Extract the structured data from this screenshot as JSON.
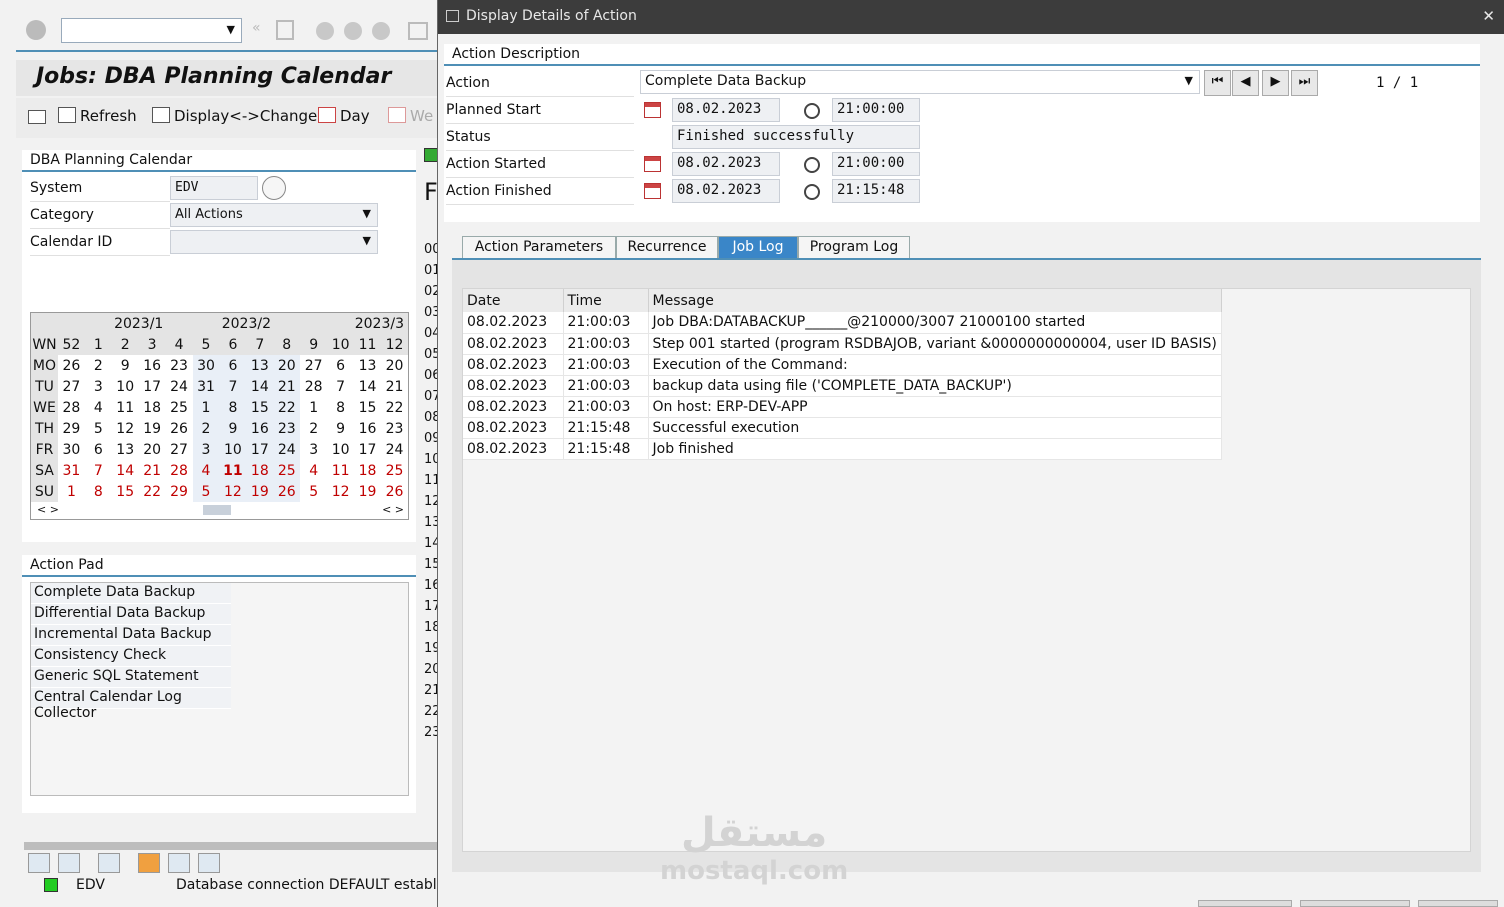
{
  "background": {
    "title": "Jobs: DBA Planning Calendar",
    "toolbar": {
      "refresh": "Refresh",
      "display_change": "Display<->Change",
      "day": "Day",
      "week": "We"
    },
    "calendar_panel": {
      "header": "DBA Planning Calendar",
      "system_label": "System",
      "system_value": "EDV",
      "category_label": "Category",
      "category_value": "All Actions",
      "calendar_id_label": "Calendar ID",
      "months": [
        "2023/1",
        "2023/2",
        "2023/3"
      ],
      "week_label": "WN",
      "weeks": [
        "52",
        "1",
        "2",
        "3",
        "4",
        "5",
        "6",
        "7",
        "8",
        "9",
        "10",
        "11",
        "12"
      ],
      "days": [
        {
          "d": "MO",
          "v": [
            "26",
            "2",
            "9",
            "16",
            "23",
            "30",
            "6",
            "13",
            "20",
            "27",
            "6",
            "13",
            "20"
          ]
        },
        {
          "d": "TU",
          "v": [
            "27",
            "3",
            "10",
            "17",
            "24",
            "31",
            "7",
            "14",
            "21",
            "28",
            "7",
            "14",
            "21"
          ]
        },
        {
          "d": "WE",
          "v": [
            "28",
            "4",
            "11",
            "18",
            "25",
            "1",
            "8",
            "15",
            "22",
            "1",
            "8",
            "15",
            "22"
          ]
        },
        {
          "d": "TH",
          "v": [
            "29",
            "5",
            "12",
            "19",
            "26",
            "2",
            "9",
            "16",
            "23",
            "2",
            "9",
            "16",
            "23"
          ]
        },
        {
          "d": "FR",
          "v": [
            "30",
            "6",
            "13",
            "20",
            "27",
            "3",
            "10",
            "17",
            "24",
            "3",
            "10",
            "17",
            "24"
          ]
        },
        {
          "d": "SA",
          "v": [
            "31",
            "7",
            "14",
            "21",
            "28",
            "4",
            "11",
            "18",
            "25",
            "4",
            "11",
            "18",
            "25"
          ]
        },
        {
          "d": "SU",
          "v": [
            "1",
            "8",
            "15",
            "22",
            "29",
            "5",
            "12",
            "19",
            "26",
            "5",
            "12",
            "19",
            "26"
          ]
        }
      ]
    },
    "action_pad": {
      "header": "Action Pad",
      "items": [
        "Complete Data Backup",
        "Differential Data Backup",
        "Incremental Data Backup",
        "Consistency Check",
        "Generic SQL Statement",
        "Central Calendar Log Collector"
      ]
    },
    "side_hours": [
      "00",
      "01",
      "02",
      "03",
      "04",
      "05",
      "06",
      "07",
      "08",
      "09",
      "10",
      "11",
      "12",
      "13",
      "14",
      "15",
      "16",
      "17",
      "18",
      "19",
      "20",
      "21",
      "22",
      "23"
    ],
    "side_letter": "F",
    "status": {
      "system": "EDV",
      "message": "Database connection DEFAULT establish"
    }
  },
  "dialog": {
    "title": "Display Details of Action",
    "section_header": "Action Description",
    "action_label": "Action",
    "action_value": "Complete Data Backup",
    "pager": "1 / 1",
    "planned_start_label": "Planned Start",
    "planned_start_date": "08.02.2023",
    "planned_start_time": "21:00:00",
    "status_label": "Status",
    "status_value": "Finished successfully",
    "action_started_label": "Action Started",
    "action_started_date": "08.02.2023",
    "action_started_time": "21:00:00",
    "action_finished_label": "Action Finished",
    "action_finished_date": "08.02.2023",
    "action_finished_time": "21:15:48",
    "tabs": [
      "Action Parameters",
      "Recurrence",
      "Job Log",
      "Program Log"
    ],
    "active_tab": "Job Log",
    "log_columns": [
      "Date",
      "Time",
      "Message"
    ],
    "log_rows": [
      [
        "08.02.2023",
        "21:00:03",
        "Job DBA:DATABACKUP______@210000/3007 21000100 started"
      ],
      [
        "08.02.2023",
        "21:00:03",
        "Step 001 started (program RSDBAJOB, variant &0000000000004, user ID BASIS)"
      ],
      [
        "08.02.2023",
        "21:00:03",
        "Execution of the Command:"
      ],
      [
        "08.02.2023",
        "21:00:03",
        "backup data using file ('COMPLETE_DATA_BACKUP')"
      ],
      [
        "08.02.2023",
        "21:00:03",
        "On host: ERP-DEV-APP"
      ],
      [
        "08.02.2023",
        "21:15:48",
        "Successful execution"
      ],
      [
        "08.02.2023",
        "21:15:48",
        "Job finished"
      ]
    ]
  },
  "watermark": {
    "arabic": "مستقل",
    "latin": "mostaql.com"
  },
  "colors": {
    "accent": "#4f8fb6",
    "active_tab": "#3a86c8",
    "weekend": "#c00000",
    "title_bar": "#3c3c3c"
  }
}
